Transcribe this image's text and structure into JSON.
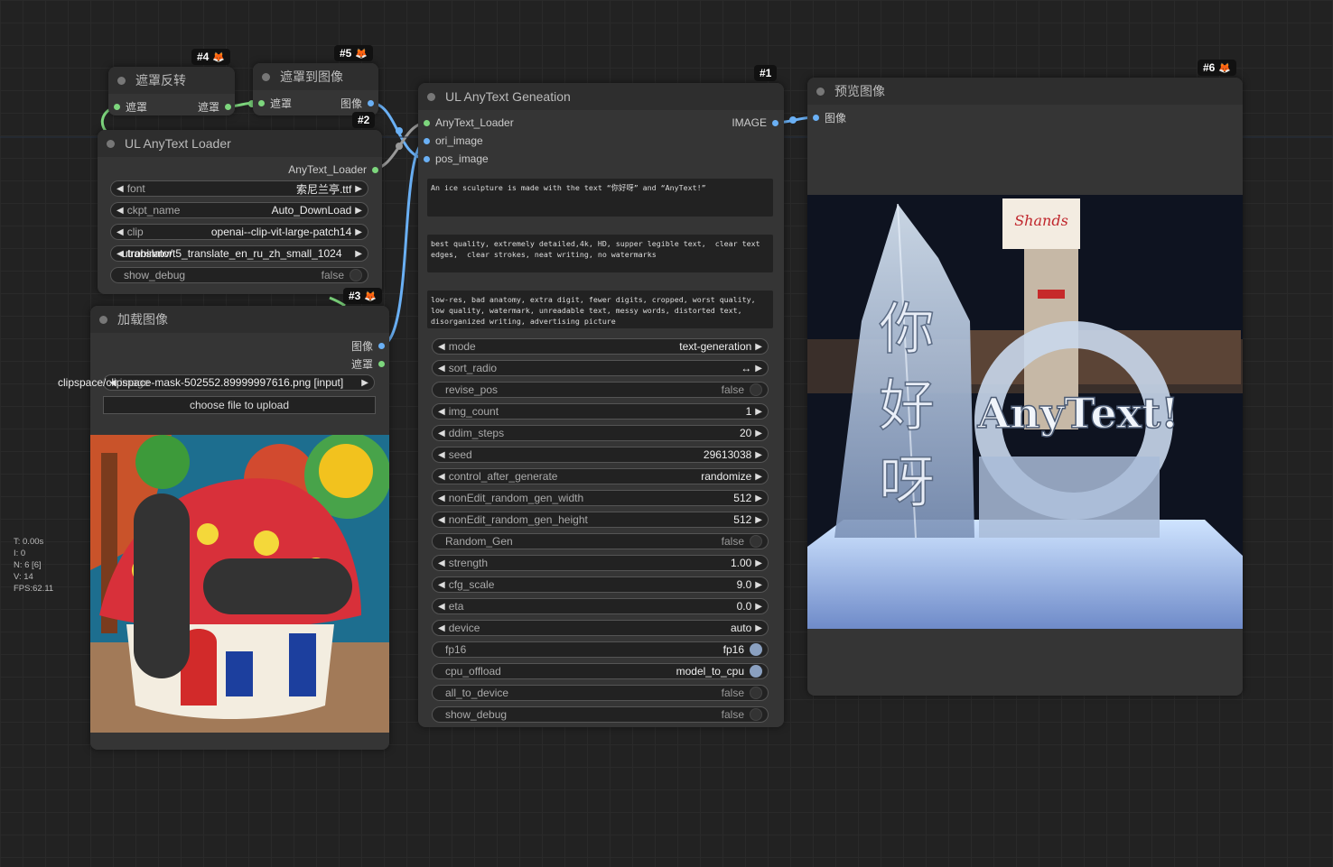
{
  "nodes": {
    "invert": {
      "badge": "#4",
      "title": "遮罩反转",
      "in_label": "遮罩",
      "out_label": "遮罩"
    },
    "mask2img": {
      "badge": "#5",
      "title": "遮罩到图像",
      "in_label": "遮罩",
      "out_label": "图像"
    },
    "loader": {
      "badge": "#2",
      "title": "UL AnyText Loader",
      "out_label": "AnyText_Loader",
      "widgets": [
        {
          "label": "font",
          "value": "索尼兰亭.ttf"
        },
        {
          "label": "ckpt_name",
          "value": "Auto_DownLoad"
        },
        {
          "label": "clip",
          "value": "openai--clip-vit-large-patch14"
        },
        {
          "label": "translator",
          "value": "utrobinmv/t5_translate_en_ru_zh_small_1024"
        }
      ],
      "show_debug": {
        "label": "show_debug",
        "value": "false"
      }
    },
    "loadimg": {
      "badge": "#3",
      "title": "加载图像",
      "out_image": "图像",
      "out_mask": "遮罩",
      "image_widget": {
        "label": "image",
        "value": "clipspace/clipspace-mask-502552.89999997616.png [input]"
      },
      "upload_label": "choose file to upload"
    },
    "gen": {
      "badge": "#1",
      "title": "UL AnyText Geneation",
      "inputs": [
        "AnyText_Loader",
        "ori_image",
        "pos_image"
      ],
      "output": "IMAGE",
      "prompt": "An ice sculpture is made with the text “你好呀” and “AnyText!”",
      "a_prompt": "best quality, extremely detailed,4k, HD, supper legible text,  clear text edges,  clear strokes, neat writing, no watermarks",
      "n_prompt": "low-res, bad anatomy, extra digit, fewer digits, cropped, worst quality, low quality, watermark, unreadable text, messy words, distorted text, disorganized writing, advertising picture",
      "widgets": [
        {
          "label": "mode",
          "value": "text-generation",
          "kind": "combo"
        },
        {
          "label": "sort_radio",
          "value": "↔",
          "kind": "combo"
        },
        {
          "label": "revise_pos",
          "value": "false",
          "kind": "toggle",
          "on": false
        },
        {
          "label": "img_count",
          "value": "1",
          "kind": "combo"
        },
        {
          "label": "ddim_steps",
          "value": "20",
          "kind": "combo"
        },
        {
          "label": "seed",
          "value": "29613038",
          "kind": "combo"
        },
        {
          "label": "control_after_generate",
          "value": "randomize",
          "kind": "combo"
        },
        {
          "label": "nonEdit_random_gen_width",
          "value": "512",
          "kind": "combo"
        },
        {
          "label": "nonEdit_random_gen_height",
          "value": "512",
          "kind": "combo"
        },
        {
          "label": "Random_Gen",
          "value": "false",
          "kind": "toggle",
          "on": false
        },
        {
          "label": "strength",
          "value": "1.00",
          "kind": "combo"
        },
        {
          "label": "cfg_scale",
          "value": "9.0",
          "kind": "combo"
        },
        {
          "label": "eta",
          "value": "0.0",
          "kind": "combo"
        },
        {
          "label": "device",
          "value": "auto",
          "kind": "combo"
        },
        {
          "label": "fp16",
          "value": "fp16",
          "kind": "toggle",
          "on": true
        },
        {
          "label": "cpu_offload",
          "value": "model_to_cpu",
          "kind": "toggle",
          "on": true
        },
        {
          "label": "all_to_device",
          "value": "false",
          "kind": "toggle",
          "on": false
        },
        {
          "label": "show_debug",
          "value": "false",
          "kind": "toggle",
          "on": false
        }
      ]
    },
    "preview": {
      "badge": "#6",
      "title": "预览图像",
      "in_label": "图像",
      "image_text": {
        "chars": [
          "你",
          "好",
          "呀"
        ],
        "latin": "AnyText!",
        "sign": "Shands"
      }
    }
  },
  "stats": [
    "T: 0.00s",
    "I: 0",
    "N: 6 [6]",
    "V: 14",
    "FPS:62.11"
  ],
  "colors": {
    "canvas": "#222222",
    "node": "#353535",
    "title": "#2e2e2e",
    "link_blue": "#6ab0f5",
    "link_green": "#7dd67d"
  }
}
